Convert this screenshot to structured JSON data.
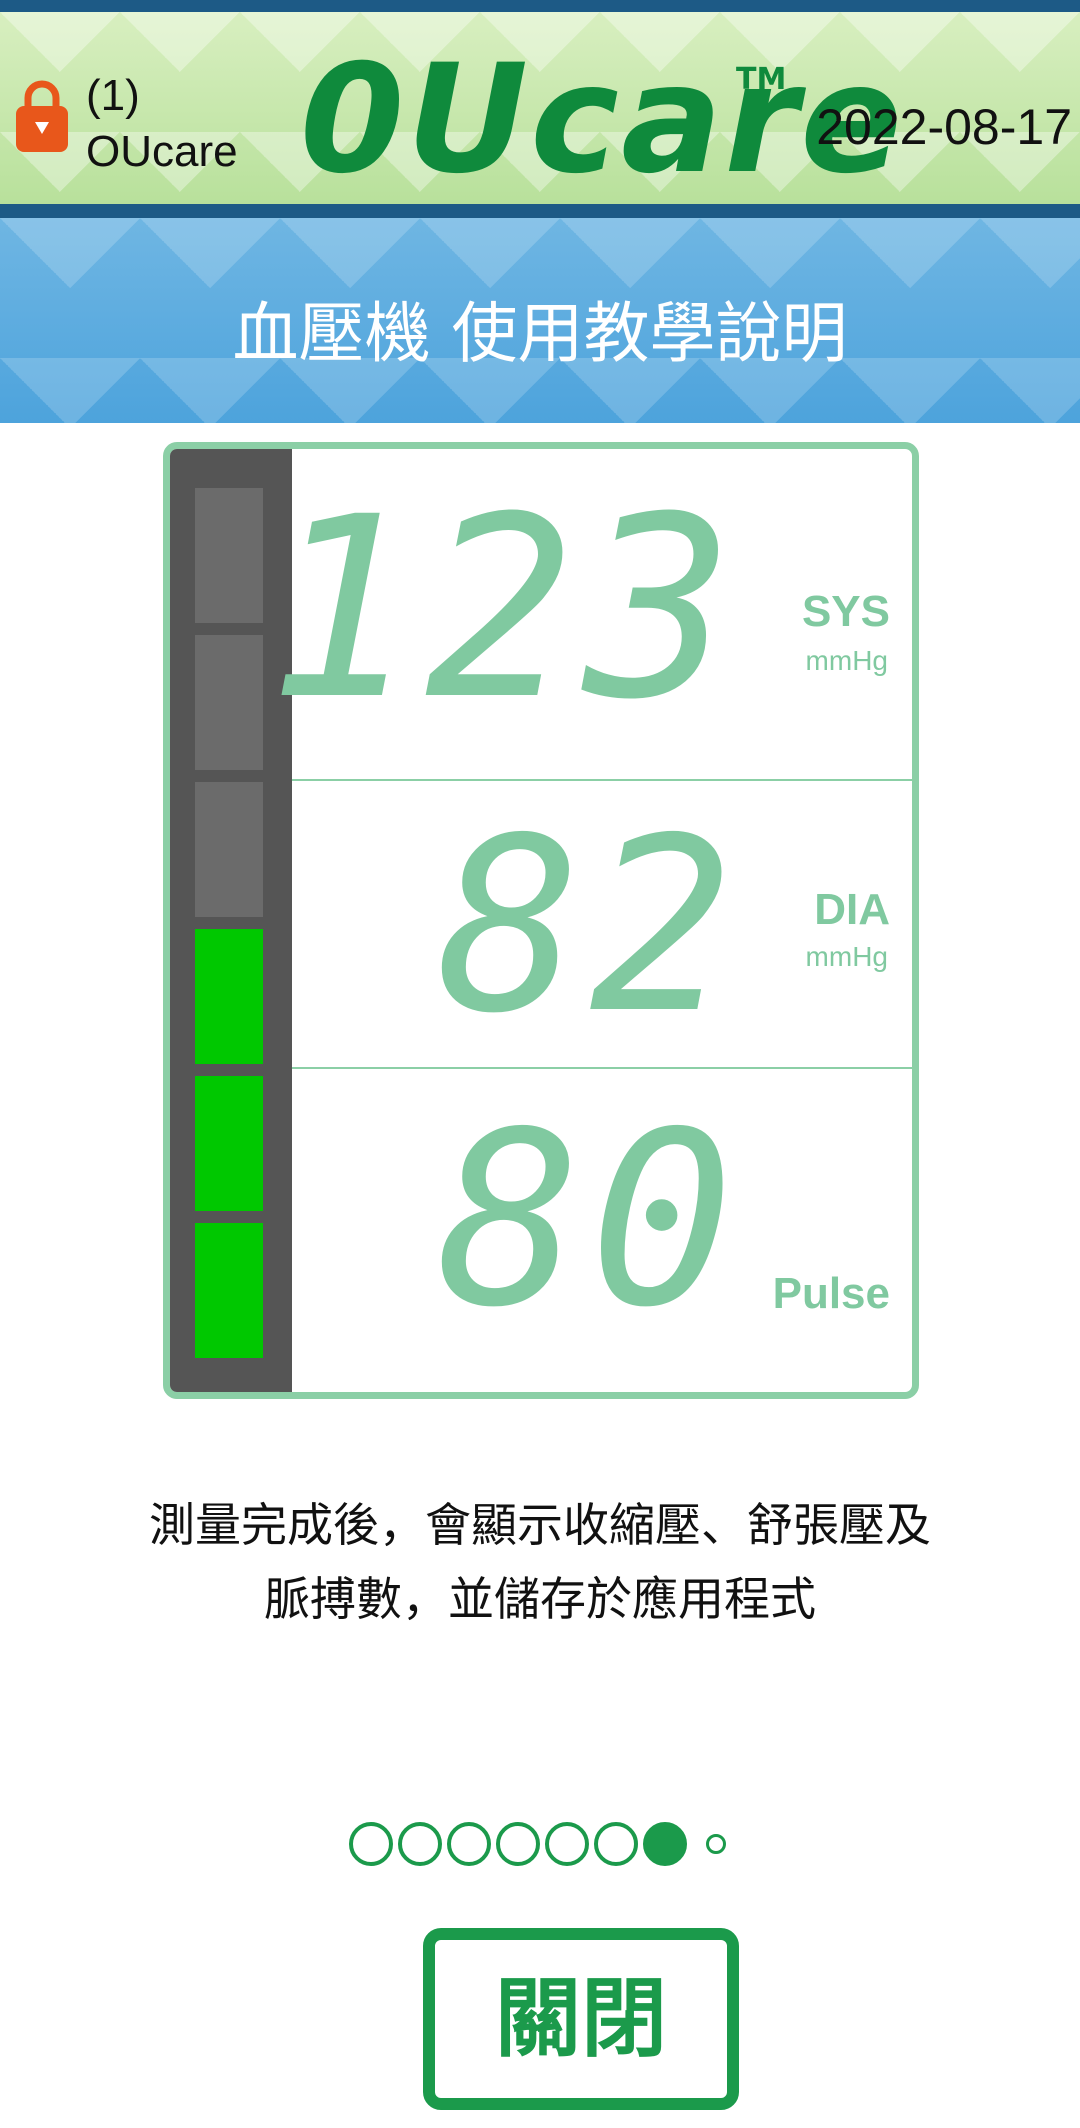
{
  "header": {
    "user_label_line1": "(1)",
    "user_label_line2": "OUcare",
    "logo_text": "0Ucare",
    "logo_tm": "TM",
    "date": "2022-08-17",
    "lock_icon": "lock-icon"
  },
  "title": "血壓機 使用教學說明",
  "device_display": {
    "sys_value": "123",
    "sys_label": "SYS",
    "sys_unit": "mmHg",
    "dia_value": "82",
    "dia_label": "DIA",
    "dia_unit": "mmHg",
    "pulse_value": "80",
    "pulse_label": "Pulse",
    "level_segments": [
      false,
      false,
      false,
      true,
      true,
      true
    ],
    "colors": {
      "segment_on": "#00c800",
      "segment_off": "#6b6b6b",
      "digits": "#80c9a0"
    }
  },
  "description_line1": "測量完成後，會顯示收縮壓、舒張壓及",
  "description_line2": "脈搏數，並儲存於應用程式",
  "pagination": {
    "total": 8,
    "current": 7
  },
  "close_button": "關閉",
  "colors": {
    "accent": "#1b9a4b",
    "header_bar": "#1d5a86",
    "title_bg": "#4da3dc"
  }
}
